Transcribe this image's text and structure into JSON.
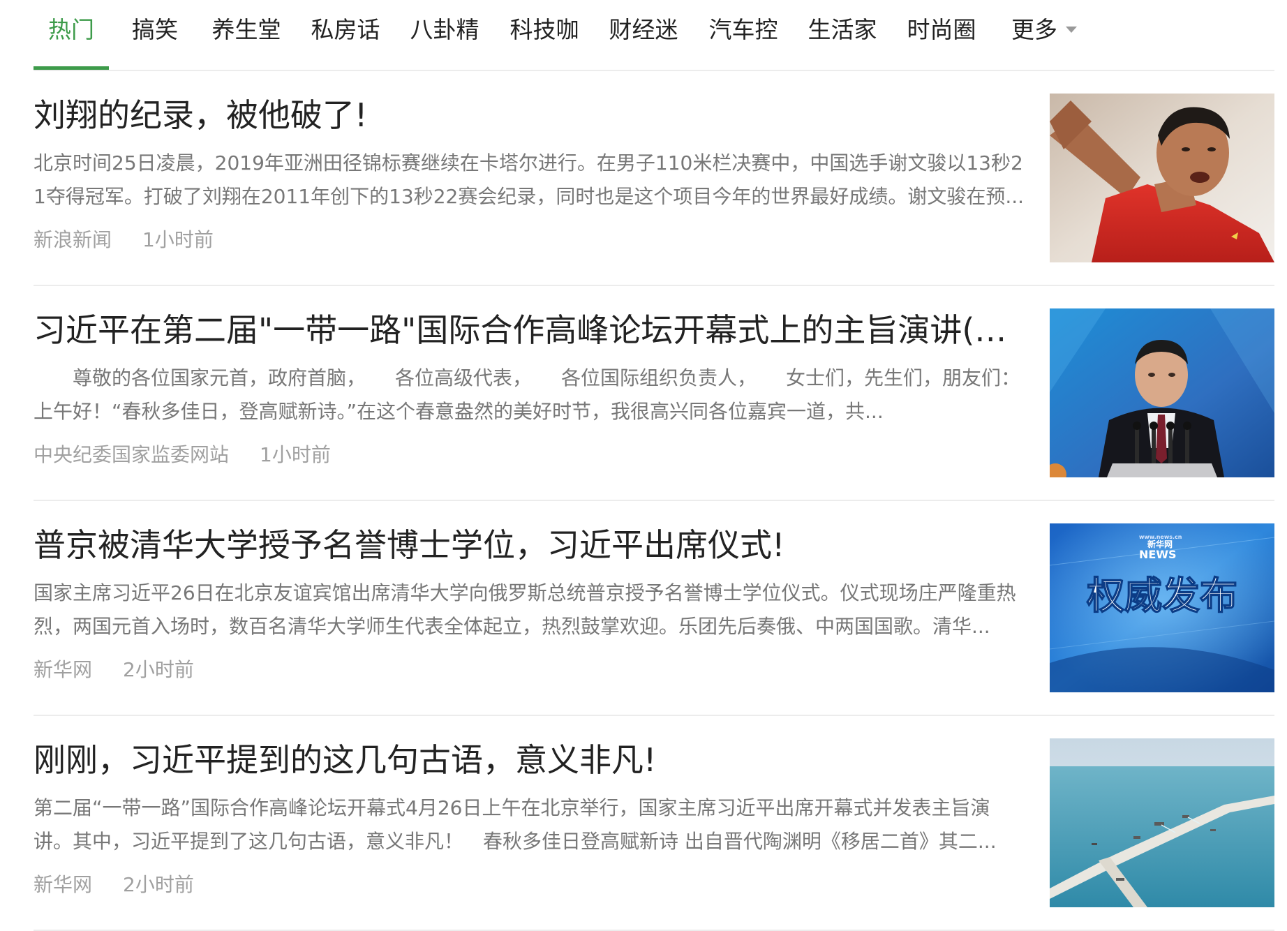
{
  "tabs": [
    {
      "label": "热门",
      "active": true
    },
    {
      "label": "搞笑"
    },
    {
      "label": "养生堂"
    },
    {
      "label": "私房话"
    },
    {
      "label": "八卦精"
    },
    {
      "label": "科技咖"
    },
    {
      "label": "财经迷"
    },
    {
      "label": "汽车控"
    },
    {
      "label": "生活家"
    },
    {
      "label": "时尚圈"
    },
    {
      "label": "更多",
      "icon": "chevron-down-icon"
    }
  ],
  "articles": [
    {
      "title": "刘翔的纪录，被他破了!",
      "summary": "北京时间25日凌晨，2019年亚洲田径锦标赛继续在卡塔尔进行。在男子110米栏决赛中，中国选手谢文骏以13秒21夺得冠军。打破了刘翔在2011年创下的13秒22赛会纪录，同时也是这个项目今年的世界最好成绩。谢文骏在预...",
      "source": "新浪新闻",
      "time": "1小时前",
      "image": "athlete-photo"
    },
    {
      "title": "习近平在第二届\"一带一路\"国际合作高峰论坛开幕式上的主旨演讲(全...",
      "summary": "　　尊敬的各位国家元首，政府首脑，　　各位高级代表，　　各位国际组织负责人，　　女士们，先生们，朋友们：　　上午好！“春秋多佳日，登高赋新诗。”在这个春意盎然的美好时节，我很高兴同各位嘉宾一道，共...",
      "source": "中央纪委国家监委网站",
      "time": "1小时前",
      "image": "speaker-photo"
    },
    {
      "title": "普京被清华大学授予名誉博士学位，习近平出席仪式!",
      "summary": "国家主席习近平26日在北京友谊宾馆出席清华大学向俄罗斯总统普京授予名誉博士学位仪式。仪式现场庄严隆重热烈，两国元首入场时，数百名清华大学师生代表全体起立，热烈鼓掌欢迎。乐团先后奏俄、中两国国歌。清华...",
      "source": "新华网",
      "time": "2小时前",
      "image": "authority-release-banner",
      "image_text": "权威发布",
      "image_logo_brand": "新华网",
      "image_logo_letters": "NEWS",
      "image_logo_url": "www.news.cn"
    },
    {
      "title": "刚刚，习近平提到的这几句古语，意义非凡!",
      "summary": "第二届“一带一路”国际合作高峰论坛开幕式4月26日上午在北京举行，国家主席习近平出席开幕式并发表主旨演讲。其中，习近平提到了这几句古语，意义非凡！　春秋多佳日登高赋新诗 出自晋代陶渊明《移居二首》其二...",
      "source": "新华网",
      "time": "2小时前",
      "image": "pier-aerial-photo"
    }
  ],
  "colors": {
    "accent": "#3d9b4a",
    "title": "#222222",
    "summary": "#777777",
    "meta": "#a0a0a0",
    "divider": "#ececec"
  }
}
